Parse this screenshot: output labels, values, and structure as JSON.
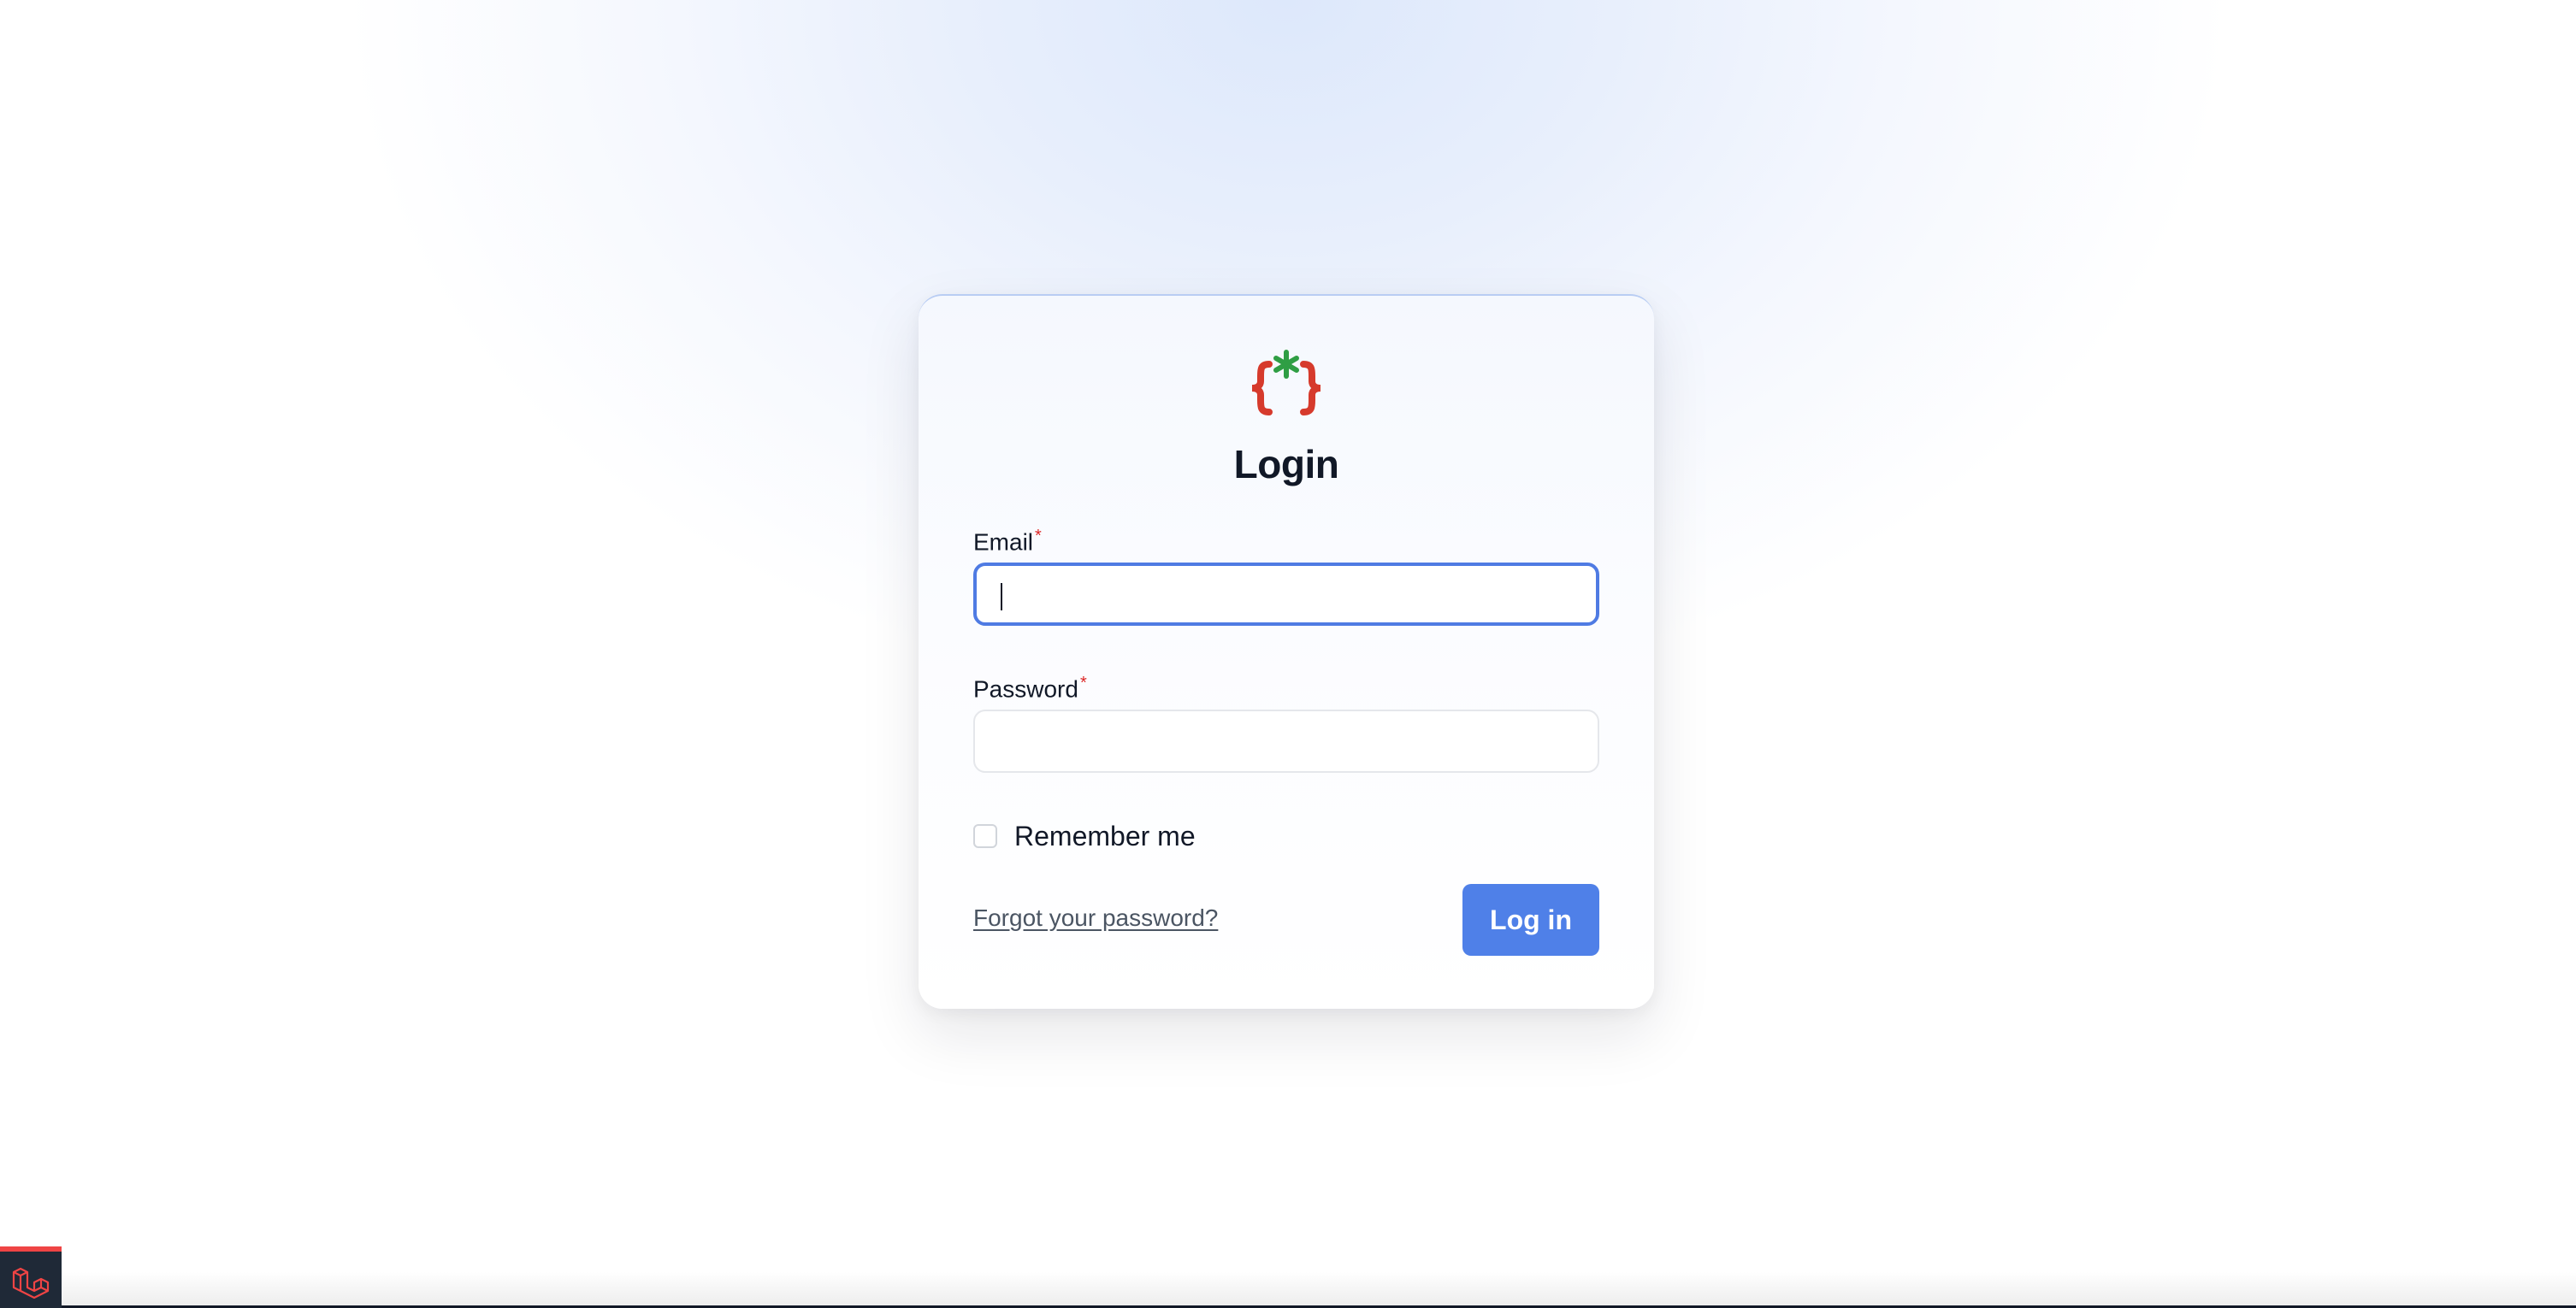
{
  "login": {
    "title": "Login",
    "email_label": "Email",
    "email_value": "",
    "password_label": "Password",
    "password_value": "",
    "required_mark": "*",
    "remember_label": "Remember me",
    "remember_checked": false,
    "forgot_link": "Forgot your password?",
    "submit_label": "Log in"
  },
  "logo": {
    "icon": "curly-braces-asterisk-logo",
    "brace_color": "#d63a2c",
    "asterisk_color": "#2f9e44"
  },
  "debug_badge": {
    "icon": "laravel-icon"
  },
  "colors": {
    "accent": "#4f80e8",
    "focus_border": "#4f7be3",
    "required": "#dc2626"
  }
}
